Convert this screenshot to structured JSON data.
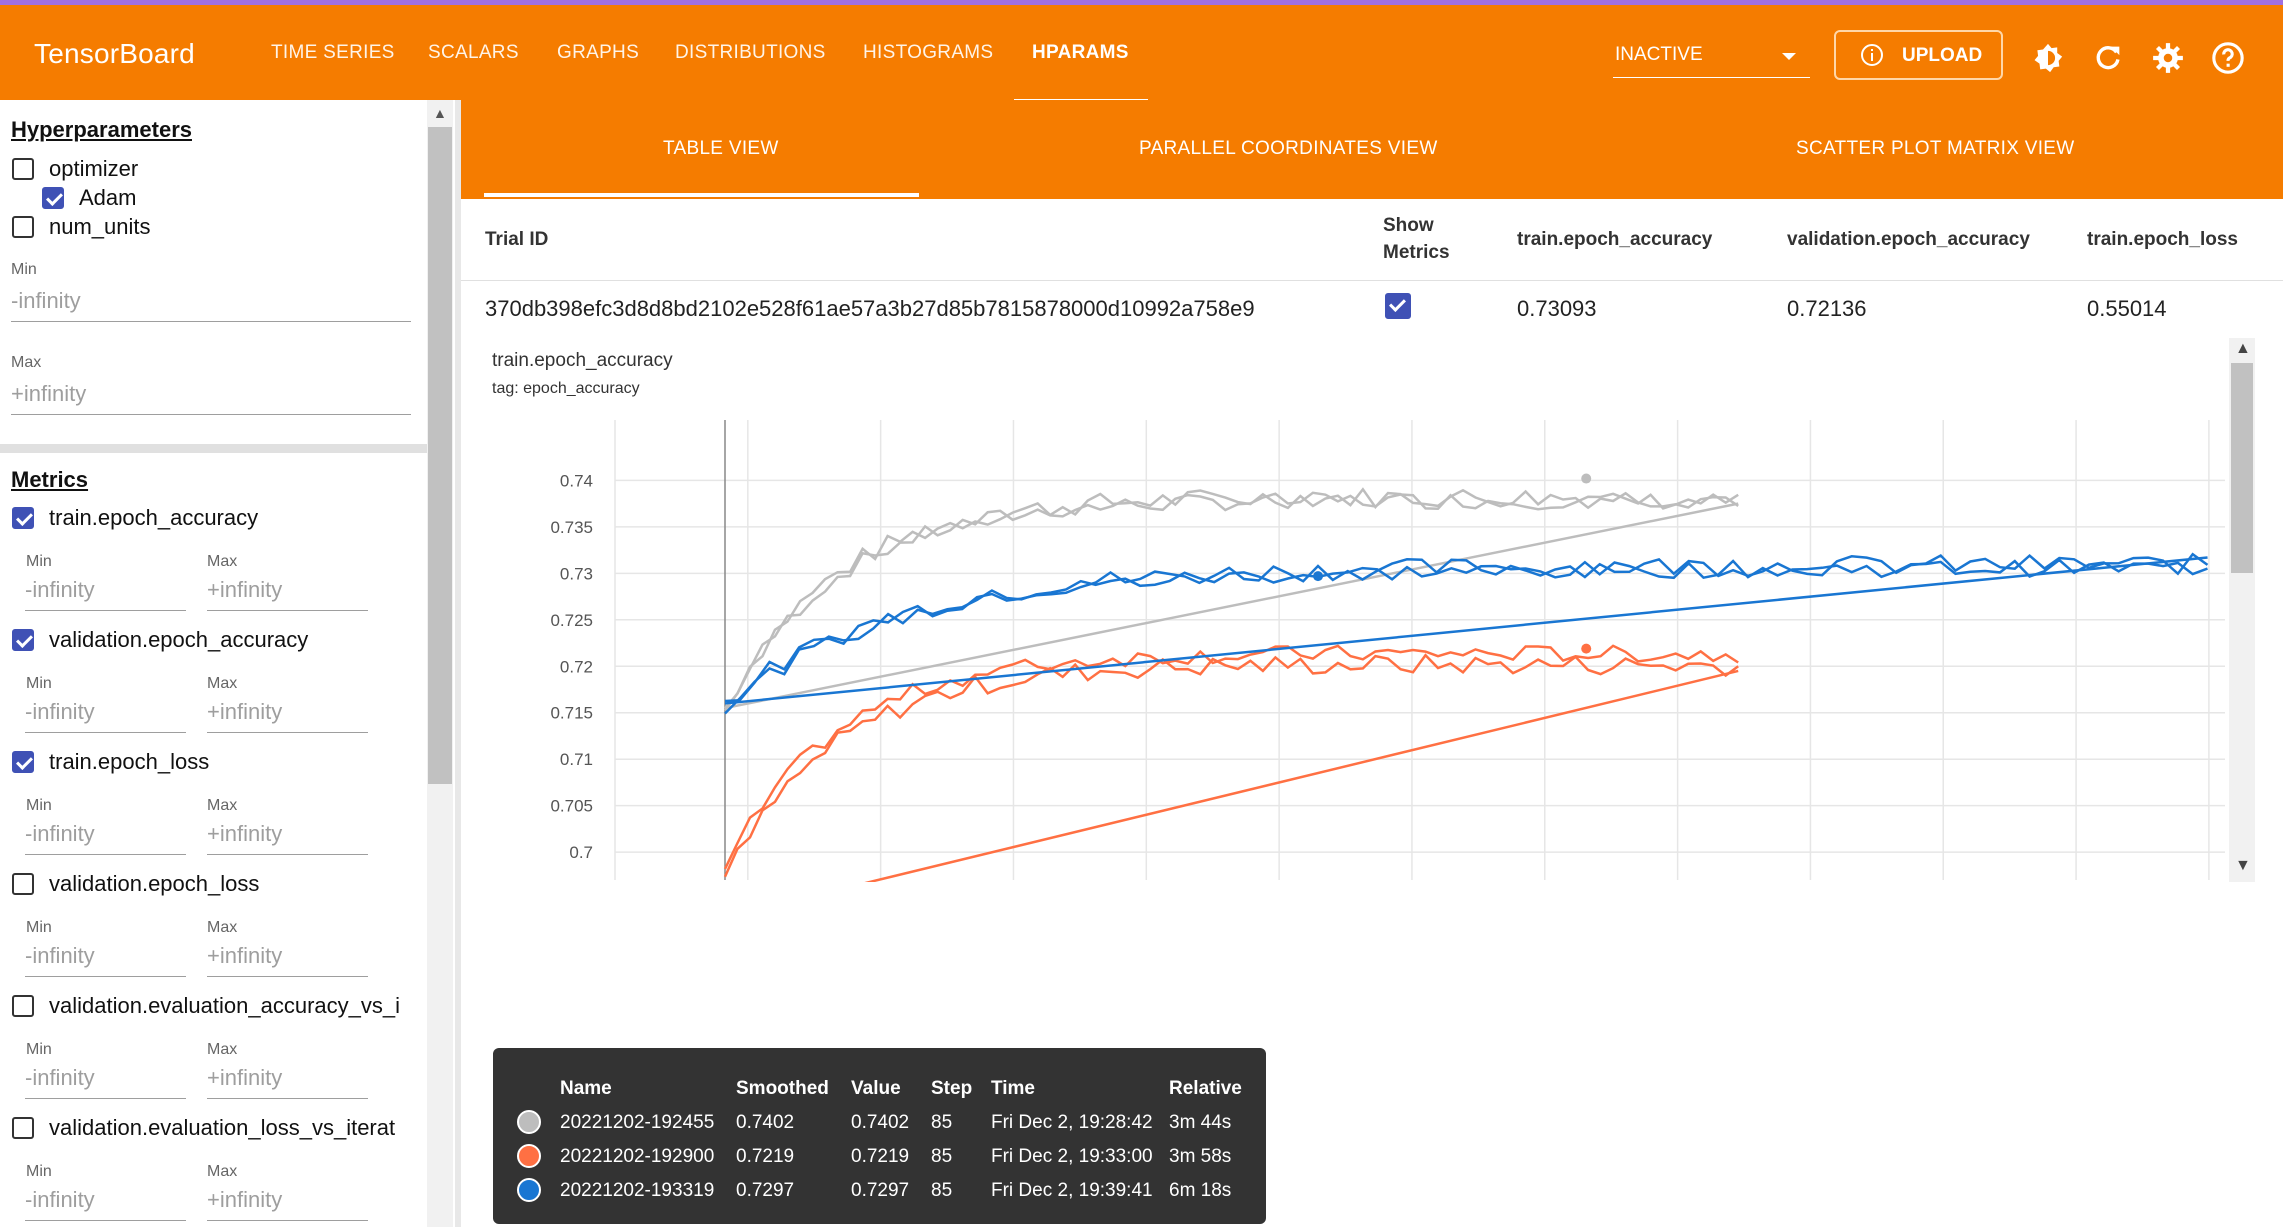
{
  "app": {
    "title": "TensorBoard"
  },
  "nav": {
    "tabs": [
      "TIME SERIES",
      "SCALARS",
      "GRAPHS",
      "DISTRIBUTIONS",
      "HISTOGRAMS",
      "HPARAMS"
    ],
    "active": "HPARAMS",
    "run_select": "INACTIVE",
    "upload_label": "UPLOAD",
    "icons": [
      "brightness-icon",
      "refresh-icon",
      "settings-icon",
      "help-icon"
    ]
  },
  "sidebar": {
    "hparams_title": "Hyperparameters",
    "hparams": [
      {
        "label": "optimizer",
        "checked": false
      },
      {
        "label": "Adam",
        "checked": true
      },
      {
        "label": "num_units",
        "checked": false
      }
    ],
    "min_label": "Min",
    "max_label": "Max",
    "min_placeholder": "-infinity",
    "max_placeholder": "+infinity",
    "metrics_title": "Metrics",
    "metrics": [
      {
        "label": "train.epoch_accuracy",
        "checked": true
      },
      {
        "label": "validation.epoch_accuracy",
        "checked": true
      },
      {
        "label": "train.epoch_loss",
        "checked": true
      },
      {
        "label": "validation.epoch_loss",
        "checked": false
      },
      {
        "label": "validation.evaluation_accuracy_vs_i",
        "checked": false
      },
      {
        "label": "validation.evaluation_loss_vs_iterat",
        "checked": false
      }
    ]
  },
  "subtabs": {
    "items": [
      "TABLE VIEW",
      "PARALLEL COORDINATES VIEW",
      "SCATTER PLOT MATRIX VIEW"
    ],
    "active": "TABLE VIEW"
  },
  "table": {
    "headers": {
      "trial_id": "Trial ID",
      "show_metrics_1": "Show",
      "show_metrics_2": "Metrics",
      "train_acc": "train.epoch_accuracy",
      "val_acc": "validation.epoch_accuracy",
      "train_loss": "train.epoch_loss"
    },
    "row": {
      "trial_id": "370db398efc3d8d8bd2102e528f61ae57a3b27d85b7815878000d10992a758e9",
      "show_metrics": true,
      "train_acc": "0.73093",
      "val_acc": "0.72136",
      "train_loss": "0.55014"
    }
  },
  "chart": {
    "title": "train.epoch_accuracy",
    "tag": "tag: epoch_accuracy"
  },
  "chart_data": {
    "type": "line",
    "title": "train.epoch_accuracy",
    "ylim": [
      0.697,
      0.7465
    ],
    "y_ticks": [
      "0.74",
      "0.735",
      "0.73",
      "0.725",
      "0.72",
      "0.715",
      "0.71",
      "0.705",
      "0.7"
    ],
    "grid": true,
    "series": [
      {
        "name": "20221202-192455",
        "color": "#bdbdbd",
        "start": 0.7155,
        "plateau": 0.7385,
        "end_y": 0.7375,
        "end_x": 0.5,
        "tooltip_step": 85,
        "tooltip_value": 0.7402
      },
      {
        "name": "20221202-192900",
        "color": "#ff7043",
        "start": 0.697,
        "plateau": 0.7205,
        "end_y": 0.7195,
        "end_x": 0.5,
        "tooltip_step": 85,
        "tooltip_value": 0.7219
      },
      {
        "name": "20221202-193319",
        "color": "#1976d2",
        "start": 0.716,
        "plateau": 0.7305,
        "end_y": 0.7317,
        "end_x": 1.0,
        "tooltip_step": 85,
        "tooltip_value": 0.7297
      }
    ]
  },
  "tooltip": {
    "headers": [
      "Name",
      "Smoothed",
      "Value",
      "Step",
      "Time",
      "Relative"
    ],
    "rows": [
      {
        "color": "#bdbdbd",
        "name": "20221202-192455",
        "smoothed": "0.7402",
        "value": "0.7402",
        "step": "85",
        "time": "Fri Dec 2, 19:28:42",
        "relative": "3m 44s"
      },
      {
        "color": "#ff7043",
        "name": "20221202-192900",
        "smoothed": "0.7219",
        "value": "0.7219",
        "step": "85",
        "time": "Fri Dec 2, 19:33:00",
        "relative": "3m 58s"
      },
      {
        "color": "#1976d2",
        "name": "20221202-193319",
        "smoothed": "0.7297",
        "value": "0.7297",
        "step": "85",
        "time": "Fri Dec 2, 19:39:41",
        "relative": "6m 18s"
      }
    ]
  }
}
